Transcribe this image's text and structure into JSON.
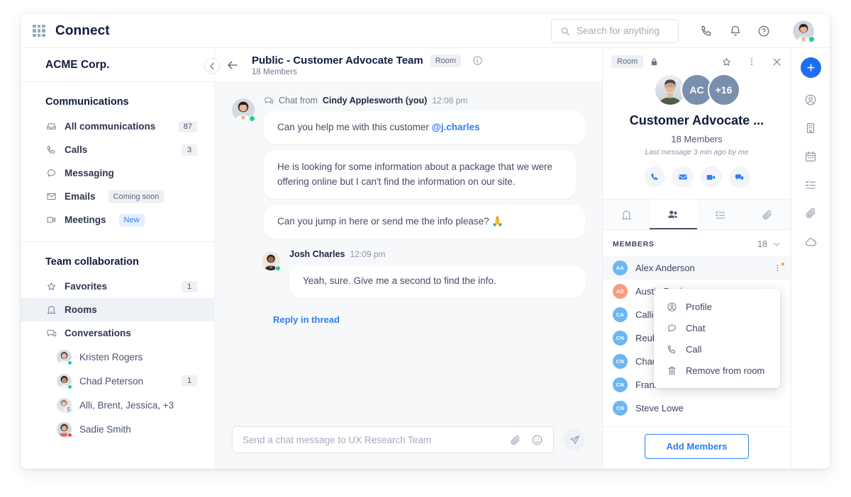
{
  "topbar": {
    "brand": "Connect",
    "grid_icon": "apps-grid-icon",
    "search": {
      "placeholder": "Search for anything",
      "value": ""
    },
    "icons": [
      "phone-icon",
      "bell-icon",
      "help-circle-icon"
    ],
    "user_status": "online"
  },
  "sidebar": {
    "org_name": "ACME Corp.",
    "collapse_icon": "chevron-left-icon",
    "sections": [
      {
        "title": "Communications",
        "items": [
          {
            "label": "All communications",
            "icon": "inbox-icon",
            "badge": "87"
          },
          {
            "label": "Calls",
            "icon": "phone-icon",
            "badge": "3"
          },
          {
            "label": "Messaging",
            "icon": "chat-bubble-icon",
            "badge": ""
          },
          {
            "label": "Emails",
            "icon": "envelope-icon",
            "badge": "",
            "pill": "Coming soon",
            "pill_style": "gray"
          },
          {
            "label": "Meetings",
            "icon": "video-camera-icon",
            "badge": "",
            "pill": "New",
            "pill_style": "blue"
          }
        ]
      },
      {
        "title": "Team collaboration",
        "items": [
          {
            "label": "Favorites",
            "icon": "star-icon",
            "badge": "1"
          },
          {
            "label": "Rooms",
            "icon": "building-icon",
            "badge": "",
            "active": true
          },
          {
            "label": "Conversations",
            "icon": "chats-icon",
            "badge": ""
          }
        ]
      }
    ],
    "conversations": [
      {
        "name": "Kristen Rogers",
        "badge": "",
        "status": "green",
        "count": ""
      },
      {
        "name": "Chad Peterson",
        "badge": "1",
        "status": "green",
        "count": ""
      },
      {
        "name": "Alli, Brent, Jessica, +3",
        "badge": "",
        "status": "",
        "count": "5"
      },
      {
        "name": "Sadie Smith",
        "badge": "",
        "status": "red",
        "count": ""
      }
    ]
  },
  "chat": {
    "back_icon": "arrow-left-icon",
    "title": "Public - Customer Advocate Team",
    "type_pill": "Room",
    "subtitle": "18 Members",
    "info_icon": "info-circle-icon",
    "thread": {
      "source_label": "Chat from",
      "author": "Cindy Applesworth (you)",
      "time": "12:08 pm",
      "messages": [
        {
          "text": "Can you help me with this customer ",
          "mention": "@j.charles"
        },
        {
          "text": "He is looking for some information about a package that we were offering online but I can't find the information on our site.",
          "mention": ""
        },
        {
          "text": "Can you jump in here or send me the info please? 🙏",
          "mention": ""
        }
      ]
    },
    "reply": {
      "author": "Josh Charles",
      "time": "12:09 pm",
      "message": "Yeah, sure. Give me a second to find the info."
    },
    "reply_link": "Reply in thread",
    "composer": {
      "placeholder": "Send a chat message to UX Research Team",
      "value": "",
      "attach_icon": "paperclip-icon",
      "emoji_icon": "smiley-icon",
      "send_icon": "send-icon"
    }
  },
  "rightpanel": {
    "room_pill": "Room",
    "lock_icon": "lock-icon",
    "star_icon": "star-icon",
    "kebab_icon": "kebab-menu-icon",
    "close_icon": "close-icon",
    "avatars": [
      {
        "type": "photo",
        "label": ""
      },
      {
        "type": "initials",
        "label": "AC"
      },
      {
        "type": "overflow",
        "label": "+16"
      }
    ],
    "room_name": "Customer Advocate ...",
    "members_count": "18 Members",
    "last_message": "Last message 3 min ago by me",
    "quick_actions": [
      "phone-icon",
      "envelope-icon",
      "video-camera-icon",
      "chats-icon"
    ],
    "tabs": [
      {
        "icon": "building-icon",
        "active": false
      },
      {
        "icon": "people-icon",
        "active": true
      },
      {
        "icon": "task-list-icon",
        "active": false
      },
      {
        "icon": "paperclip-icon",
        "active": false
      }
    ],
    "list_header": {
      "label": "MEMBERS",
      "count": "18",
      "chevron": "chevron-down-icon"
    },
    "members": [
      {
        "initials": "AA",
        "name": "Alex Anderson",
        "color": "#6cb6f2",
        "active": true
      },
      {
        "initials": "AD",
        "name": "Austin Davis",
        "color": "#f79b7f",
        "active": false
      },
      {
        "initials": "CA",
        "name": "Callie Adams",
        "color": "#6cb6f2",
        "active": false
      },
      {
        "initials": "CN",
        "name": "Reuben Nelson",
        "color": "#6cb6f2",
        "active": false
      },
      {
        "initials": "CN",
        "name": "Chad Nelson",
        "color": "#6cb6f2",
        "active": false
      },
      {
        "initials": "CN",
        "name": "Frank Meza",
        "color": "#6cb6f2",
        "active": false
      },
      {
        "initials": "CN",
        "name": "Steve Lowe",
        "color": "#6cb6f2",
        "active": false
      }
    ],
    "context_menu": [
      {
        "label": "Profile",
        "icon": "user-circle-icon"
      },
      {
        "label": "Chat",
        "icon": "chat-bubble-icon"
      },
      {
        "label": "Call",
        "icon": "phone-icon"
      },
      {
        "label": "Remove from room",
        "icon": "trash-icon"
      }
    ],
    "add_members_label": "Add Members"
  },
  "rail": {
    "plus_icon": "plus-icon",
    "items": [
      "user-circle-icon",
      "building-icon",
      "calendar-icon",
      "task-list-icon",
      "paperclip-icon",
      "cloud-icon"
    ]
  },
  "colors": {
    "accent": "#2f7df6",
    "rail_accent": "#1e6ef0",
    "title": "#101b3d",
    "online": "#20c997",
    "busy": "#f4405c"
  }
}
